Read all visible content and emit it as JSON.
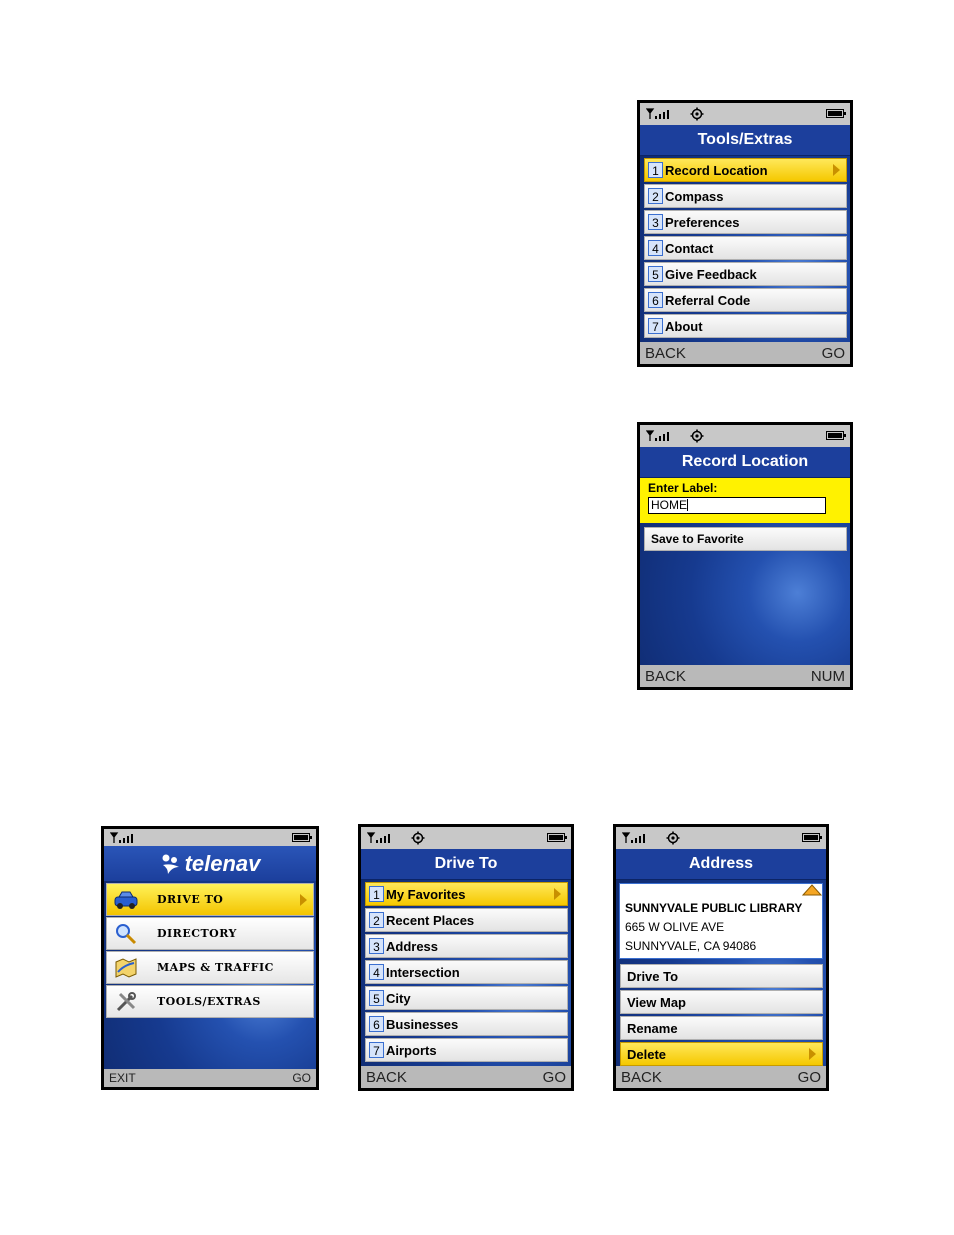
{
  "screen_tools": {
    "title": "Tools/Extras",
    "items": [
      {
        "num": "1",
        "label": "Record Location"
      },
      {
        "num": "2",
        "label": "Compass"
      },
      {
        "num": "3",
        "label": "Preferences"
      },
      {
        "num": "4",
        "label": "Contact"
      },
      {
        "num": "5",
        "label": "Give Feedback"
      },
      {
        "num": "6",
        "label": "Referral Code"
      },
      {
        "num": "7",
        "label": "About"
      }
    ],
    "soft_left": "BACK",
    "soft_right": "GO"
  },
  "screen_record": {
    "title": "Record Location",
    "label_prompt": "Enter Label:",
    "label_value": "HOME",
    "save_label": "Save to Favorite",
    "soft_left": "BACK",
    "soft_right": "NUM"
  },
  "screen_main": {
    "logo_text": "telenav",
    "items": [
      {
        "label": "DRIVE TO",
        "icon": "car-icon"
      },
      {
        "label": "DIRECTORY",
        "icon": "magnifier-icon"
      },
      {
        "label": "MAPS & TRAFFIC",
        "icon": "map-icon"
      },
      {
        "label": "TOOLS/EXTRAS",
        "icon": "tools-icon"
      }
    ],
    "soft_left": "EXIT",
    "soft_right": "GO"
  },
  "screen_drive": {
    "title": "Drive To",
    "items": [
      {
        "num": "1",
        "label": "My Favorites"
      },
      {
        "num": "2",
        "label": "Recent Places"
      },
      {
        "num": "3",
        "label": "Address"
      },
      {
        "num": "4",
        "label": "Intersection"
      },
      {
        "num": "5",
        "label": "City"
      },
      {
        "num": "6",
        "label": "Businesses"
      },
      {
        "num": "7",
        "label": "Airports"
      }
    ],
    "soft_left": "BACK",
    "soft_right": "GO"
  },
  "screen_address": {
    "title": "Address",
    "name": "SUNNYVALE PUBLIC LIBRARY",
    "street": "665 W OLIVE AVE",
    "city": "SUNNYVALE, CA 94086",
    "items": [
      "Drive To",
      "View Map",
      "Rename",
      "Delete"
    ],
    "soft_left": "BACK",
    "soft_right": "GO"
  },
  "colors": {
    "title_blue": "#1c3f9c",
    "highlight_yellow": "#f5c800",
    "status_gray": "#c8c8c8"
  }
}
